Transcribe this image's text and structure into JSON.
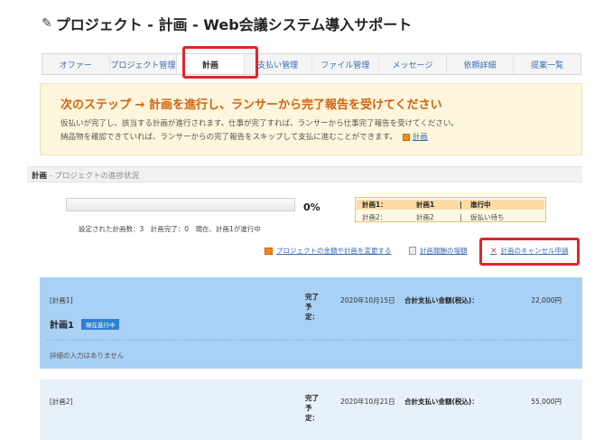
{
  "page_title": "プロジェクト - 計画 - Web会議システム導入サポート",
  "tabs": [
    {
      "label": "オファー"
    },
    {
      "label": "プロジェクト管理"
    },
    {
      "label": "計画"
    },
    {
      "label": "支払い管理"
    },
    {
      "label": "ファイル管理"
    },
    {
      "label": "メッセージ"
    },
    {
      "label": "依頼詳細"
    },
    {
      "label": "提案一覧"
    }
  ],
  "active_tab": "計画",
  "notice": {
    "headline": "次のステップ → 計画を進行し、ランサーから完了報告を受けてください",
    "line1": "仮払いが完了し、該当する計画が進行されます。仕事が完了すれば、ランサーから仕事完了報告を受けてください。",
    "line2": "納品物を確認できていれば、ランサーからの完了報告をスキップして支払に進むことができます。",
    "link": "計画"
  },
  "section": {
    "title": "計画",
    "subtitle": " - プロジェクトの進捗状況"
  },
  "progress": {
    "percent_text": "0%",
    "value": 0,
    "summary": "設定された計画数：3　計画完了：0　現在、計画1が進行中"
  },
  "status_table": [
    {
      "col1": "計画1：",
      "col2": "計画1",
      "sep": "|",
      "col3": "進行中"
    },
    {
      "col1": "計画2：",
      "col2": "計画2",
      "sep": "|",
      "col3": "仮払い待ち"
    }
  ],
  "actions": {
    "change_amount": "プロジェクトの金額や計画を変更する",
    "add_reward": "計画報酬の増額",
    "cancel_request": "計画のキャンセル申請"
  },
  "plans": [
    {
      "label": "[計画1]",
      "name": "計画1",
      "badge": "現在進行中",
      "due_label": "完了予定：",
      "due_date": "2020年10月15日",
      "pay_label": "合計支払い金額(税込)：",
      "amount": "22,000円",
      "detail": "詳細の入力はありません"
    },
    {
      "label": "[計画2]",
      "due_label": "完了予定：",
      "due_date": "2020年10月21日",
      "pay_label": "合計支払い金額(税込)：",
      "amount": "55,000円"
    }
  ],
  "colors": {
    "accent_orange": "#d4610f",
    "link_blue": "#3a6db5",
    "highlight_red": "#e3242b",
    "plan_active_bg": "#a9d1f5"
  }
}
